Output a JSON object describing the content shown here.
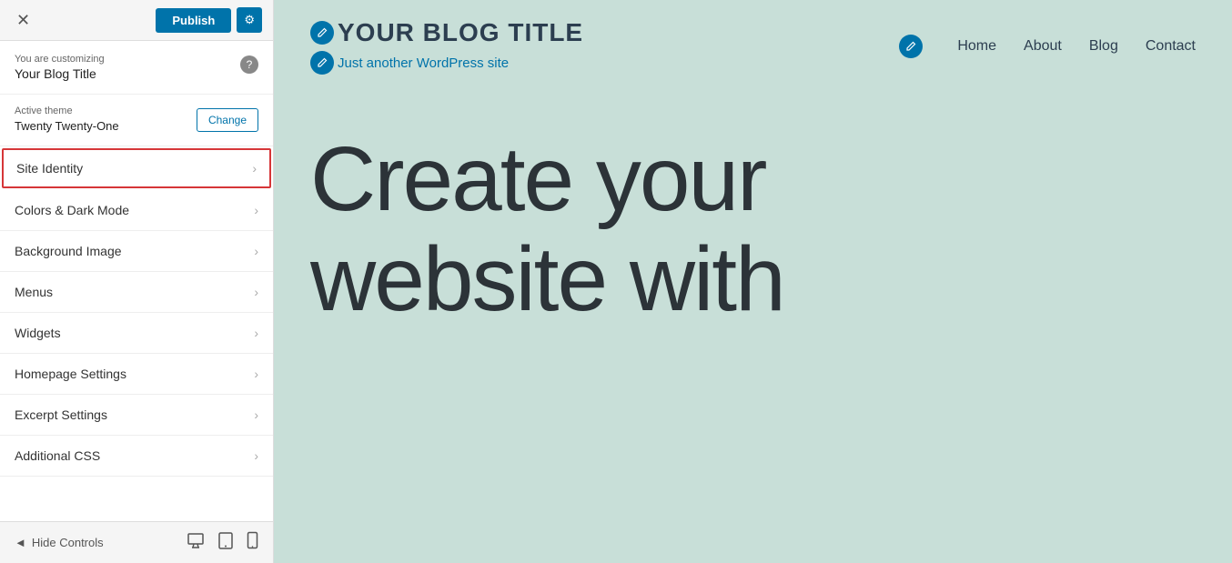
{
  "header": {
    "close_label": "✕",
    "publish_label": "Publish",
    "gear_label": "⚙"
  },
  "customizing": {
    "label": "You are customizing",
    "title": "Your Blog Title",
    "help_icon": "?"
  },
  "active_theme": {
    "label": "Active theme",
    "name": "Twenty Twenty-One",
    "change_label": "Change"
  },
  "menu_items": [
    {
      "id": "site-identity",
      "label": "Site Identity",
      "highlighted": true
    },
    {
      "id": "colors-dark-mode",
      "label": "Colors & Dark Mode",
      "highlighted": false
    },
    {
      "id": "background-image",
      "label": "Background Image",
      "highlighted": false
    },
    {
      "id": "menus",
      "label": "Menus",
      "highlighted": false
    },
    {
      "id": "widgets",
      "label": "Widgets",
      "highlighted": false
    },
    {
      "id": "homepage-settings",
      "label": "Homepage Settings",
      "highlighted": false
    },
    {
      "id": "excerpt-settings",
      "label": "Excerpt Settings",
      "highlighted": false
    },
    {
      "id": "additional-css",
      "label": "Additional CSS",
      "highlighted": false
    }
  ],
  "footer": {
    "hide_controls_label": "Hide Controls",
    "arrow_icon": "◄",
    "desktop_icon": "🖥",
    "tablet_icon": "⬜",
    "mobile_icon": "📱"
  },
  "preview": {
    "site_title": "YOUR BLOG TITLE",
    "site_tagline": "Just another WordPress site",
    "nav_links": [
      "Home",
      "About",
      "Blog",
      "Contact"
    ],
    "hero_line1": "Create your",
    "hero_line2": "website with",
    "background_color": "#c8dfd8"
  }
}
